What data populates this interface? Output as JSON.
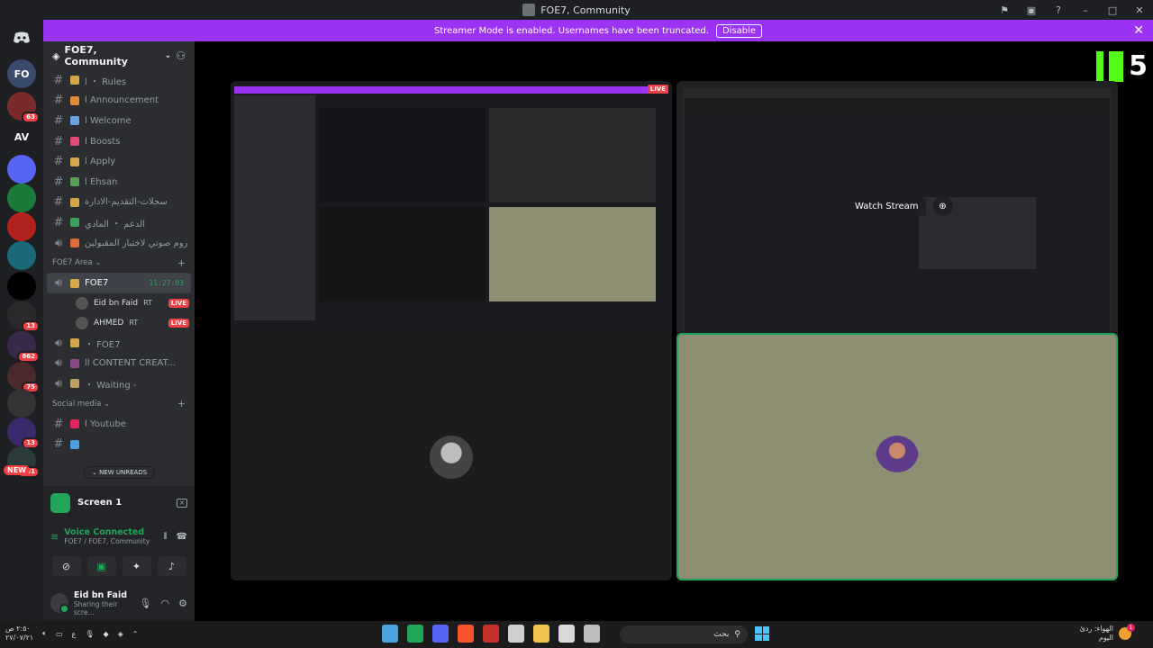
{
  "window": {
    "title": "FOE7, Community"
  },
  "banner": {
    "text": "Streamer Mode is enabled. Usernames have been truncated.",
    "disable_label": "Disable"
  },
  "rail": {
    "icons": [
      {
        "label": "FO",
        "badge": "",
        "color": "#3a4a6b"
      },
      {
        "label": "",
        "badge": "63",
        "color": "#7a2a2a"
      },
      {
        "label": "AV",
        "badge": "",
        "color": "#1e1f22"
      },
      {
        "label": "",
        "badge": "",
        "color": "#5865f2"
      },
      {
        "label": "",
        "badge": "",
        "color": "#1a7a3a"
      },
      {
        "label": "",
        "badge": "",
        "color": "#b0221b"
      },
      {
        "label": "",
        "badge": "",
        "color": "#1a6a7a"
      },
      {
        "label": "",
        "badge": "",
        "color": "#000000"
      },
      {
        "label": "",
        "badge": "13",
        "color": "#2a2a2a"
      },
      {
        "label": "",
        "badge": "862",
        "color": "#3a2a4a"
      },
      {
        "label": "",
        "badge": "75",
        "color": "#4a2a2a"
      },
      {
        "label": "",
        "badge": "",
        "color": "#333333"
      },
      {
        "label": "",
        "badge": "13",
        "color": "#3a2a6b"
      },
      {
        "label": "",
        "badge": "131",
        "color": "#2a3a3a"
      }
    ],
    "new_label": "NEW"
  },
  "sidebar": {
    "server_name": "FOE7, Community",
    "channels": [
      {
        "type": "text",
        "label": "ا ・ Rules",
        "color": "#d4a84b"
      },
      {
        "type": "text",
        "label": "ا Announcement",
        "color": "#e08a3a"
      },
      {
        "type": "text",
        "label": "ا Welcome",
        "color": "#6aa0e0"
      },
      {
        "type": "text",
        "label": "ا Boosts",
        "color": "#e04a7a"
      },
      {
        "type": "text",
        "label": "ا Apply",
        "color": "#d4a84b"
      },
      {
        "type": "text",
        "label": "ا Ehsan",
        "color": "#5aa05a"
      },
      {
        "type": "text",
        "label": "سجلات-التقديم-الادارة",
        "color": "#d4a84b"
      },
      {
        "type": "text",
        "label": "الدعم ・ المادي",
        "color": "#3aa05a"
      },
      {
        "type": "voice",
        "label": "روم صوتي لاختبار المقبولين",
        "color": "#e06a3a"
      }
    ],
    "foe7_area": {
      "label": "FOE7 Area",
      "active": {
        "label": "FOE7",
        "time": "11:27:03"
      },
      "members": [
        {
          "name": "Eid bn Faid",
          "tags": "RT",
          "live": "LIVE"
        },
        {
          "name": "AHMED",
          "tags": "RT",
          "live": "LIVE"
        }
      ],
      "channels": [
        {
          "label": "・ FOE7",
          "color": "#d4a84b"
        },
        {
          "label": "اا CONTENT CREAT...",
          "color": "#8a4a8a"
        },
        {
          "label": "・ Waiting -",
          "color": "#c0a060"
        }
      ]
    },
    "social": {
      "label": "Social media",
      "channels": [
        {
          "type": "text",
          "label": "ا Youtube",
          "color": "#e0245e"
        },
        {
          "type": "text",
          "label": "",
          "color": "#4aa0e0"
        }
      ],
      "new_unreads": "NEW UNREADS"
    }
  },
  "panel": {
    "screen_label": "Screen 1",
    "voice_status": "Voice Connected",
    "voice_location": "FOE7 / FOE7, Community",
    "user_name": "Eid bn Faid",
    "user_status": "Sharing their scre..."
  },
  "stage": {
    "live_label": "LIVE",
    "watch_stream_label": "Watch Stream",
    "mini_watch_label": "Watch Stream",
    "logo_number": "5"
  },
  "taskbar": {
    "clock_time": "٢:٥٠ ص",
    "clock_date": "٢٧/٠٧/٢١",
    "lang": "ع",
    "search_placeholder": "بحث",
    "weather_line1": "الهواء: ردئ",
    "weather_line2": "اليوم"
  }
}
